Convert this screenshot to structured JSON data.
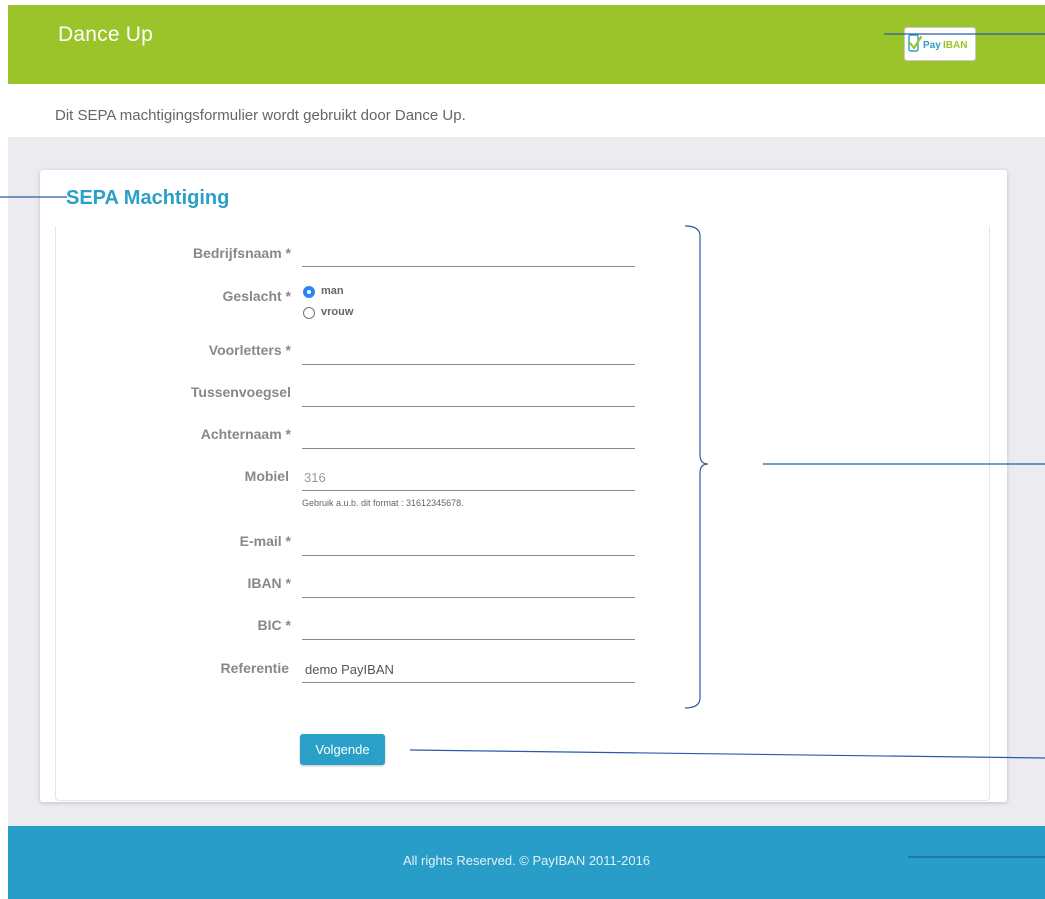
{
  "header": {
    "brand": "Dance Up",
    "logo_text_pay": "Pay",
    "logo_text_iban": "IBAN",
    "logo_icon": "phone-check-icon",
    "bg_color": "#9bc42a"
  },
  "intro_text": "Dit SEPA machtigingsformulier wordt gebruikt door Dance Up.",
  "form": {
    "title": "SEPA Machtiging",
    "fields": {
      "bedrijfsnaam": {
        "label": "Bedrijfsnaam *",
        "value": ""
      },
      "geslacht": {
        "label": "Geslacht *",
        "options": [
          "man",
          "vrouw"
        ],
        "selected": "man"
      },
      "voorletters": {
        "label": "Voorletters *",
        "value": ""
      },
      "tussenvoegsel": {
        "label": "Tussenvoegsel",
        "value": ""
      },
      "achternaam": {
        "label": "Achternaam *",
        "value": ""
      },
      "mobiel": {
        "label": "Mobiel",
        "placeholder": "316",
        "hint": "Gebruik a.u.b. dit format : 31612345678."
      },
      "email": {
        "label": "E-mail *",
        "value": ""
      },
      "iban": {
        "label": "IBAN *",
        "value": ""
      },
      "bic": {
        "label": "BIC *",
        "value": ""
      },
      "referentie": {
        "label": "Referentie",
        "value": "demo PayIBAN"
      }
    },
    "submit_label": "Volgende",
    "accent_color": "#2a9fc7"
  },
  "footer": {
    "text": "All rights Reserved. © PayIBAN 2011-2016",
    "bg_color": "#289dc7"
  }
}
